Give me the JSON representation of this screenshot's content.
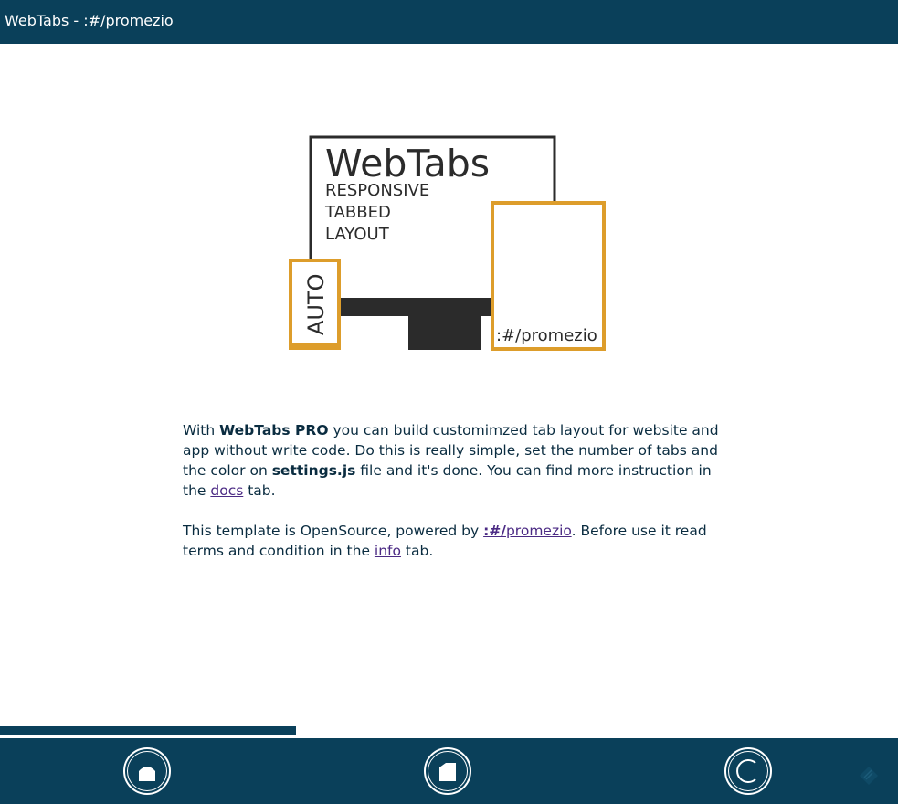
{
  "header": {
    "title": "WebTabs - :#/promezio"
  },
  "logo": {
    "wordmark": "WebTabs",
    "lines": [
      "RESPONSIVE",
      "TABBED",
      "LAYOUT"
    ],
    "auto_label": "AUTO",
    "brand_label": ":#/promezio",
    "colors": {
      "frame": "#2b2b2b",
      "accent": "#dd9d2b"
    }
  },
  "content": {
    "p1_pre": "With ",
    "p1_brand": "WebTabs PRO",
    "p1_mid": " you can build customimzed tab layout for website and app without write code. Do this is really simple, set the number of tabs and the color on ",
    "p1_file": "settings.js",
    "p1_mid2": " file and it's done. You can find more instruction in the ",
    "p1_link": "docs",
    "p1_post": " tab.",
    "p2_pre": "This template is OpenSource, powered by ",
    "p2_link_bold": ":#/",
    "p2_link_rest": "promezio",
    "p2_mid": ". Before use it read terms and condition in the ",
    "p2_link2": "info",
    "p2_post": " tab."
  },
  "progress": {
    "value": 0.33
  },
  "bottom_nav": {
    "items": [
      {
        "name": "home",
        "icon": "home-icon"
      },
      {
        "name": "docs",
        "icon": "document-icon"
      },
      {
        "name": "info",
        "icon": "copyright-icon"
      }
    ],
    "corner_icon": "feather-icon"
  },
  "colors": {
    "primary": "#0a405a",
    "text": "#0a2c40",
    "link": "#4b2a84",
    "accent": "#dd9d2b"
  }
}
